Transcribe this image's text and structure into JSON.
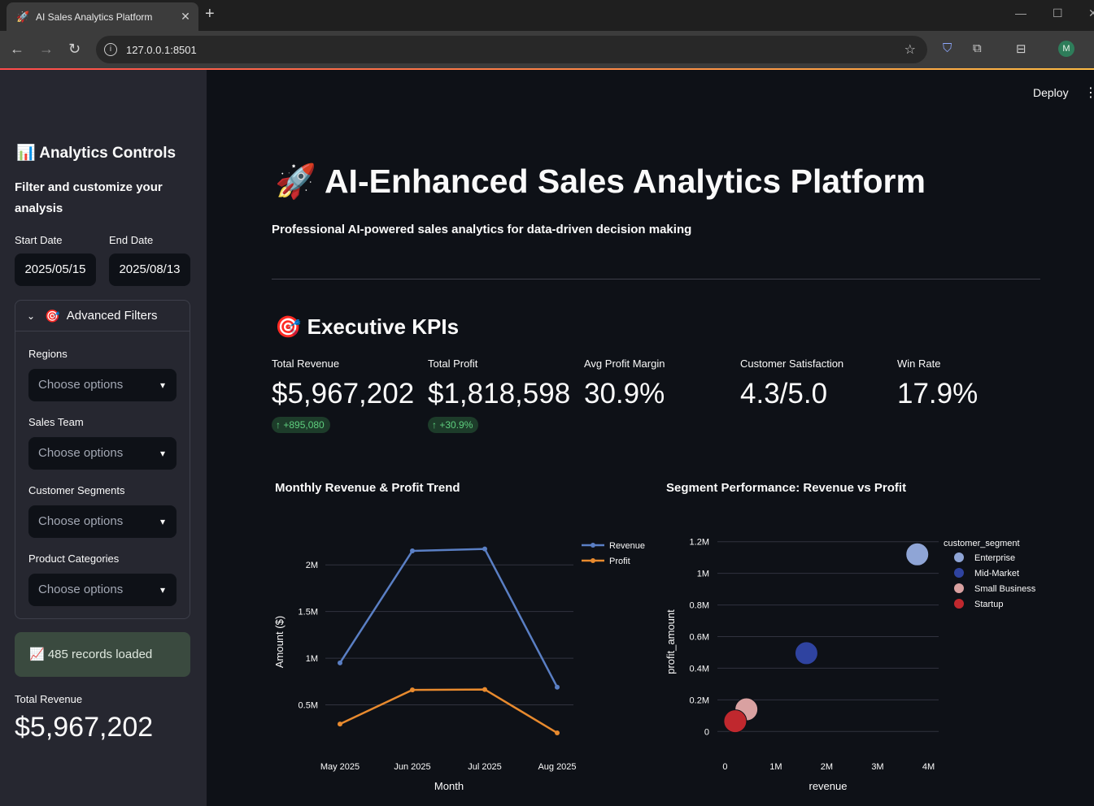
{
  "browser": {
    "tab_title": "AI Sales Analytics Platform",
    "tab_favicon": "🚀",
    "url": "127.0.0.1:8501",
    "avatar_initial": "M"
  },
  "sidebar": {
    "title": "📊 Analytics Controls",
    "subtitle": "Filter and customize your analysis",
    "start_date_label": "Start Date",
    "start_date": "2025/05/15",
    "end_date_label": "End Date",
    "end_date": "2025/08/13",
    "advanced_filters_label": "Advanced Filters",
    "filters": [
      {
        "label": "Regions",
        "placeholder": "Choose options"
      },
      {
        "label": "Sales Team",
        "placeholder": "Choose options"
      },
      {
        "label": "Customer Segments",
        "placeholder": "Choose options"
      },
      {
        "label": "Product Categories",
        "placeholder": "Choose options"
      }
    ],
    "records_info": "📈 485 records loaded",
    "metric_label": "Total Revenue",
    "metric_value": "$5,967,202"
  },
  "header": {
    "deploy_label": "Deploy",
    "title": "AI-Enhanced Sales Analytics Platform",
    "subtitle": "Professional AI-powered sales analytics for data-driven decision making"
  },
  "kpis": {
    "heading": "Executive KPIs",
    "items": [
      {
        "label": "Total Revenue",
        "value": "$5,967,202",
        "delta": "+895,080"
      },
      {
        "label": "Total Profit",
        "value": "$1,818,598",
        "delta": "+30.9%"
      },
      {
        "label": "Avg Profit Margin",
        "value": "30.9%"
      },
      {
        "label": "Customer Satisfaction",
        "value": "4.3/5.0"
      },
      {
        "label": "Win Rate",
        "value": "17.9%"
      }
    ]
  },
  "chart_data": [
    {
      "type": "line",
      "title": "Monthly Revenue & Profit Trend",
      "xlabel": "Month",
      "ylabel": "Amount ($)",
      "categories": [
        "May 2025",
        "Jun 2025",
        "Jul 2025",
        "Aug 2025"
      ],
      "y_ticks": [
        "0.5M",
        "1M",
        "1.5M",
        "2M"
      ],
      "ylim": [
        0,
        2350000
      ],
      "series": [
        {
          "name": "Revenue",
          "color": "#5a7fc4",
          "values": [
            950000,
            2150000,
            2170000,
            690000
          ]
        },
        {
          "name": "Profit",
          "color": "#e88a2e",
          "values": [
            295000,
            660000,
            665000,
            200000
          ]
        }
      ],
      "legend": "top-right",
      "grid": true
    },
    {
      "type": "scatter",
      "title": "Segment Performance: Revenue vs Profit",
      "xlabel": "revenue",
      "ylabel": "profit_amount",
      "legend_title": "customer_segment",
      "x_ticks": [
        "0",
        "1M",
        "2M",
        "3M",
        "4M"
      ],
      "y_ticks": [
        "0",
        "0.2M",
        "0.4M",
        "0.6M",
        "0.8M",
        "1M",
        "1.2M"
      ],
      "xlim": [
        -150000,
        4200000
      ],
      "ylim": [
        -50000,
        1250000
      ],
      "series": [
        {
          "name": "Enterprise",
          "color": "#8fa5d6",
          "x": 3780000,
          "y": 1120000
        },
        {
          "name": "Mid-Market",
          "color": "#2f43a0",
          "x": 1600000,
          "y": 495000
        },
        {
          "name": "Small Business",
          "color": "#d9a1a1",
          "x": 420000,
          "y": 140000
        },
        {
          "name": "Startup",
          "color": "#c0282e",
          "x": 200000,
          "y": 65000
        }
      ],
      "legend": "right",
      "grid": true
    }
  ]
}
